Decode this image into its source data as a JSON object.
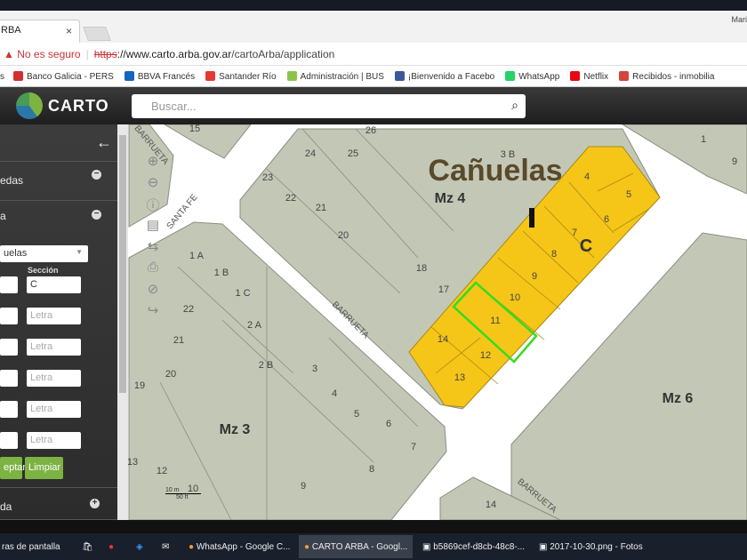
{
  "browser": {
    "tab_title": "RBA",
    "tab_close": "×",
    "user": "Mari",
    "security": "No es seguro",
    "url_scheme": "https",
    "url_host": "://www.carto.arba.gov.ar",
    "url_path": "/cartoArba/application",
    "bookmarks": [
      {
        "label": "Banco Galicia - PERS",
        "color": "#d32f2f"
      },
      {
        "label": "BBVA Francés",
        "color": "#1565c0"
      },
      {
        "label": "Santander Río",
        "color": "#e53935"
      },
      {
        "label": "Administración | BUS",
        "color": "#8bc34a"
      },
      {
        "label": "¡Bienvenido a Facebo",
        "color": "#3b5998"
      },
      {
        "label": "WhatsApp",
        "color": "#25d366"
      },
      {
        "label": "Netflix",
        "color": "#e50914"
      },
      {
        "label": "Recibidos - inmobilia",
        "color": "#d44638"
      }
    ]
  },
  "app": {
    "logo": "CARTO",
    "search_placeholder": "Buscar..."
  },
  "sidebar": {
    "back": "←",
    "section1": "edas",
    "section2": "a",
    "partido": "uelas",
    "seccion_label": "Sección",
    "seccion_value": "C",
    "letra_placeholder": "Letra",
    "accept": "eptar",
    "clear": "Limpiar",
    "section3": "da"
  },
  "map": {
    "title": "Cañuelas",
    "blocks": [
      "Mz 4",
      "Mz 3",
      "Mz 6"
    ],
    "section_letter": "C",
    "street_names": [
      "BARRUETA",
      "SANTA FE",
      "BARRUETA",
      "BARRUETA"
    ],
    "lots": [
      "15",
      "26",
      "3 B",
      "24",
      "25",
      "23",
      "22",
      "21",
      "20",
      "4",
      "5",
      "6",
      "7",
      "8",
      "9",
      "10",
      "11",
      "12",
      "13",
      "14",
      "17",
      "18",
      "1 A",
      "1 B",
      "1 C",
      "2 A",
      "2 B",
      "22",
      "21",
      "20",
      "19",
      "3",
      "4",
      "5",
      "6",
      "7",
      "8",
      "9",
      "10",
      "12",
      "13",
      "14",
      "1",
      "9",
      "10"
    ],
    "scale": {
      "m": "10 m",
      "ft": "50 ft"
    },
    "highlight_color": "#f5c518",
    "selected_color": "#33dd22"
  },
  "taskbar": {
    "items": [
      "ras de pantalla",
      "WhatsApp - Google C...",
      "CARTO ARBA - Googl...",
      "b5869cef-d8cb-48c8-...",
      "2017-10-30.png - Fotos"
    ]
  }
}
